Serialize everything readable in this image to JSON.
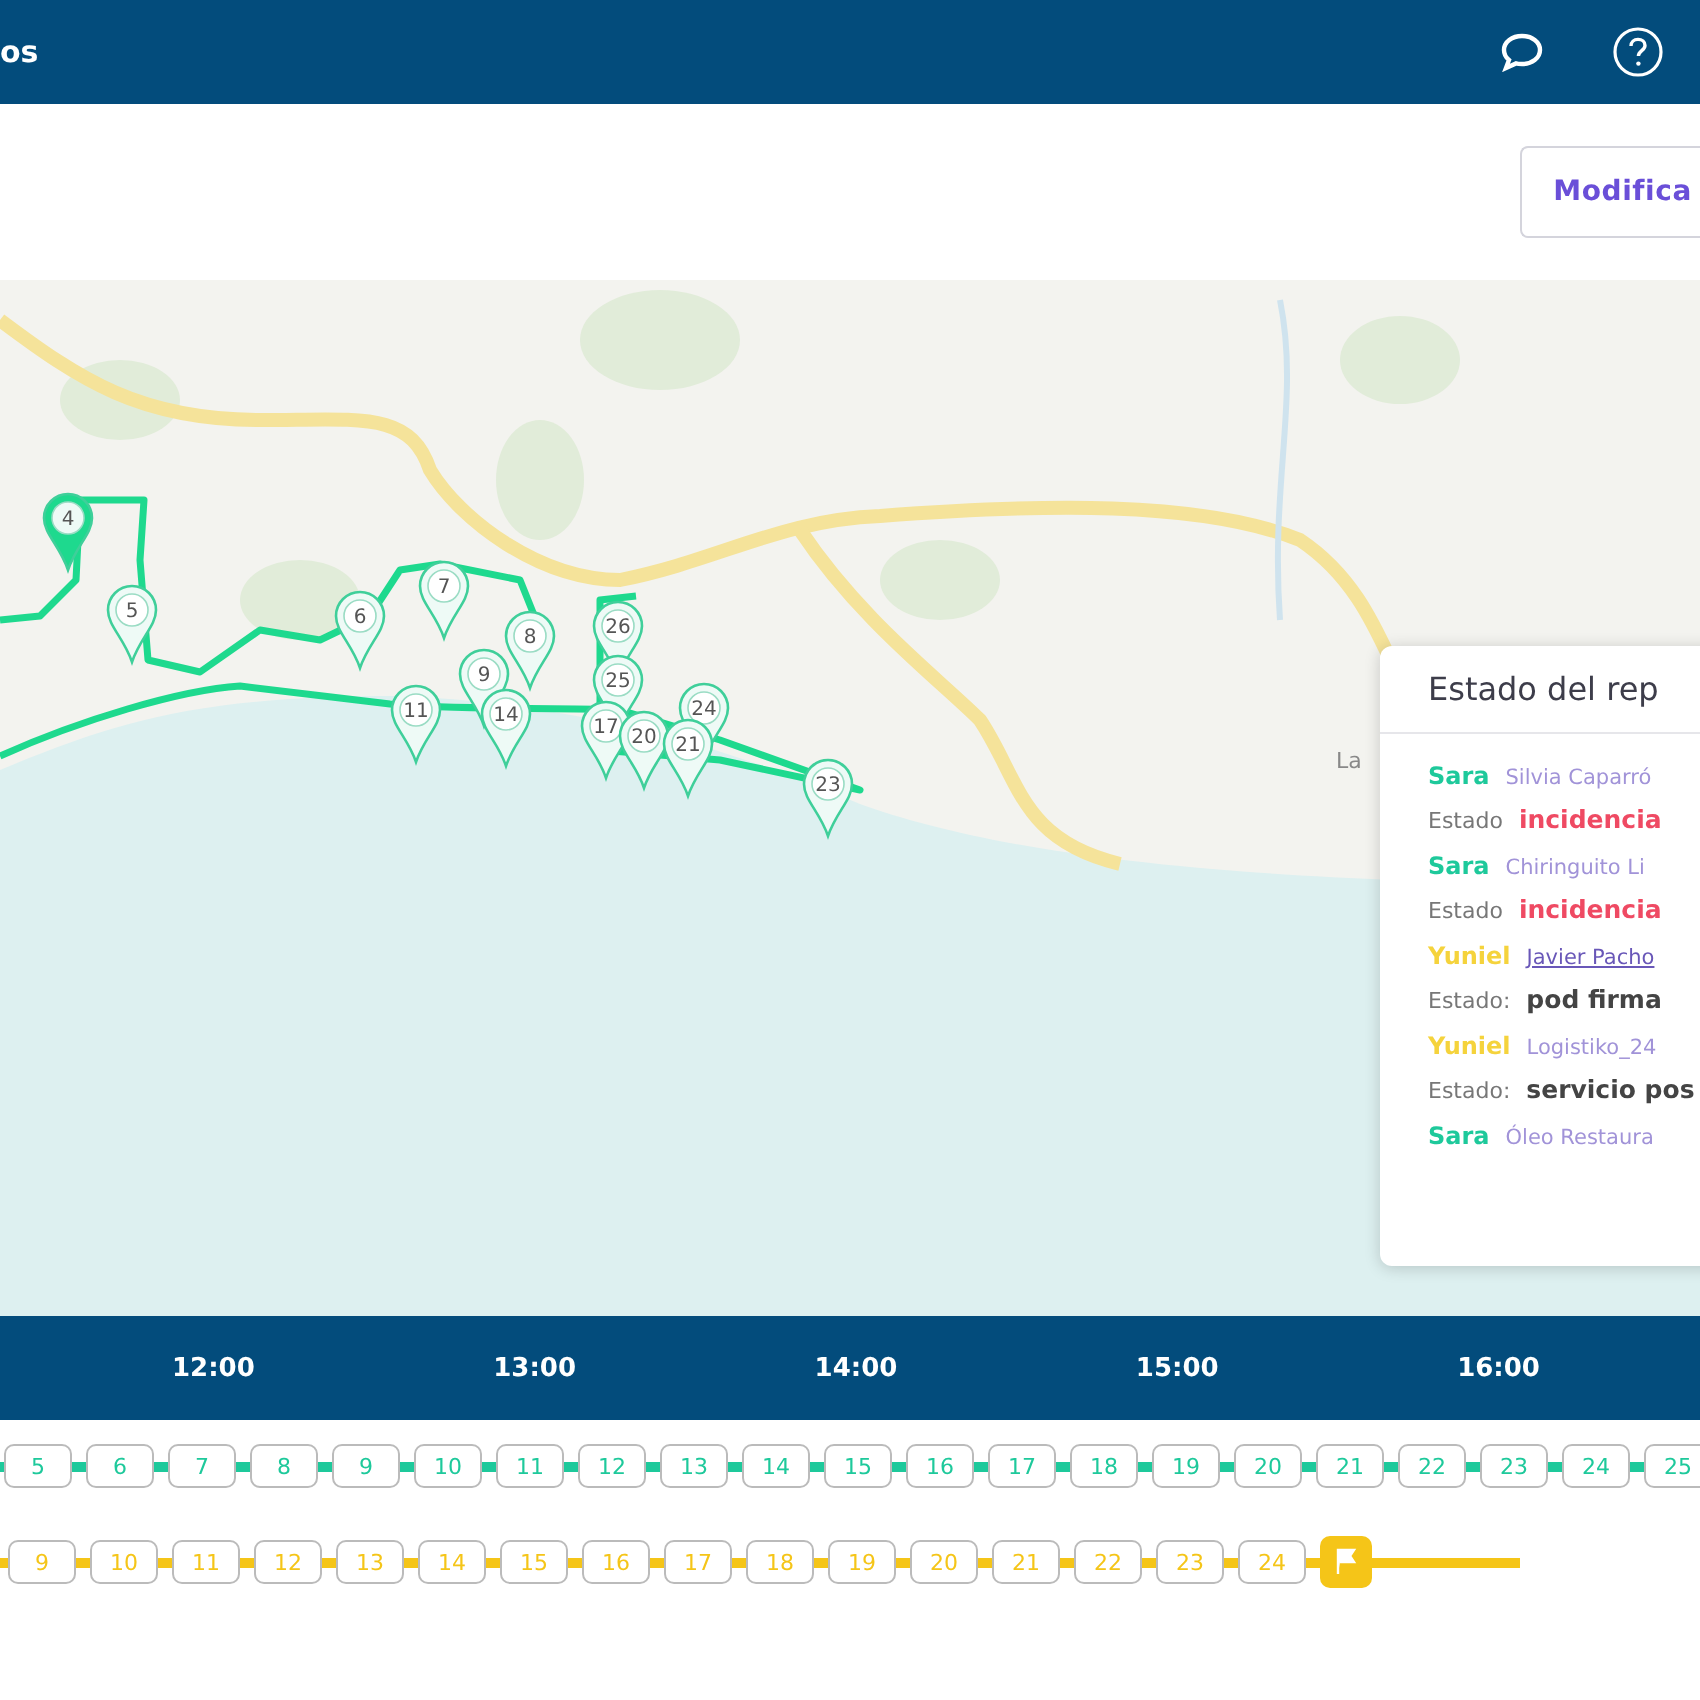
{
  "header": {
    "title": "os"
  },
  "toolbar": {
    "button": "Modifica"
  },
  "map": {
    "place_label": "La",
    "markers": [
      {
        "label": "4",
        "selected": true
      },
      {
        "label": "5",
        "selected": false
      },
      {
        "label": "6",
        "selected": false
      },
      {
        "label": "7",
        "selected": false
      },
      {
        "label": "8",
        "selected": false
      },
      {
        "label": "9",
        "selected": false
      },
      {
        "label": "11",
        "selected": false
      },
      {
        "label": "14",
        "selected": false
      },
      {
        "label": "26",
        "selected": false
      },
      {
        "label": "25",
        "selected": false
      },
      {
        "label": "24",
        "selected": false
      },
      {
        "label": "17",
        "selected": false
      },
      {
        "label": "20",
        "selected": false
      },
      {
        "label": "21",
        "selected": false
      },
      {
        "label": "23",
        "selected": false
      }
    ]
  },
  "status_panel": {
    "title": "Estado del rep",
    "entries": [
      {
        "driver": "Sara",
        "color": "#1ec99b",
        "client": "Silvia Caparró",
        "hovered": false,
        "status_label": "Estado",
        "status": "incidencia",
        "kind": "incident"
      },
      {
        "driver": "Sara",
        "color": "#1ec99b",
        "client": "Chiringuito Li",
        "hovered": false,
        "status_label": "Estado",
        "status": "incidencia",
        "kind": "incident"
      },
      {
        "driver": "Yuniel",
        "color": "#f5d33c",
        "client": "Javier Pacho",
        "hovered": true,
        "status_label": "Estado:",
        "status": "pod firma",
        "kind": "normal"
      },
      {
        "driver": "Yuniel",
        "color": "#f5d33c",
        "client": "Logistiko_24",
        "hovered": false,
        "status_label": "Estado:",
        "status": "servicio pos",
        "kind": "normal"
      },
      {
        "driver": "Sara",
        "color": "#1ec99b",
        "client": "Óleo Restaura",
        "hovered": false
      }
    ]
  },
  "timeline": {
    "hours": [
      "12:00",
      "13:00",
      "14:00",
      "15:00",
      "16:00"
    ],
    "routes": [
      {
        "color": "#1ec99b",
        "finish_flag": false,
        "stops": [
          "5",
          "6",
          "7",
          "8",
          "9",
          "10",
          "11",
          "12",
          "13",
          "14",
          "15",
          "16",
          "17",
          "18",
          "19",
          "20",
          "21",
          "22",
          "23",
          "24",
          "25"
        ]
      },
      {
        "color": "#f5c518",
        "finish_flag": true,
        "stops": [
          "9",
          "10",
          "11",
          "12",
          "13",
          "14",
          "15",
          "16",
          "17",
          "18",
          "19",
          "20",
          "21",
          "22",
          "23",
          "24"
        ]
      }
    ]
  }
}
